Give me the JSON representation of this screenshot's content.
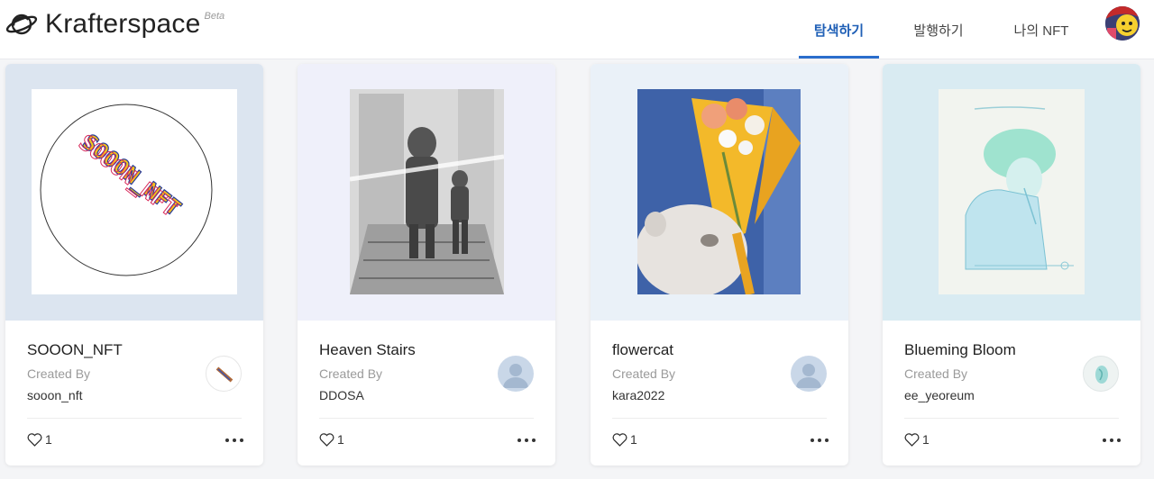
{
  "brand": {
    "name": "Krafterspace",
    "badge": "Beta"
  },
  "nav": {
    "explore": "탐색하기",
    "publish": "발행하기",
    "my_nft": "나의 NFT"
  },
  "colors": {
    "accent": "#2a6dcc",
    "active_text": "#1f5fb6"
  },
  "cards": [
    {
      "title": "SOOON_NFT",
      "created_by_label": "Created By",
      "creator": "sooon_nft",
      "likes": "1",
      "bg": "#dce5f0"
    },
    {
      "title": "Heaven Stairs",
      "created_by_label": "Created By",
      "creator": "DDOSA",
      "likes": "1",
      "bg": "#eff0fa"
    },
    {
      "title": "flowercat",
      "created_by_label": "Created By",
      "creator": "kara2022",
      "likes": "1",
      "bg": "#eaf1f8"
    },
    {
      "title": "Blueming Bloom",
      "created_by_label": "Created By",
      "creator": "ee_yeoreum",
      "likes": "1",
      "bg": "#d9ebf2"
    }
  ],
  "nft_art_text": "SOOON_NFT"
}
